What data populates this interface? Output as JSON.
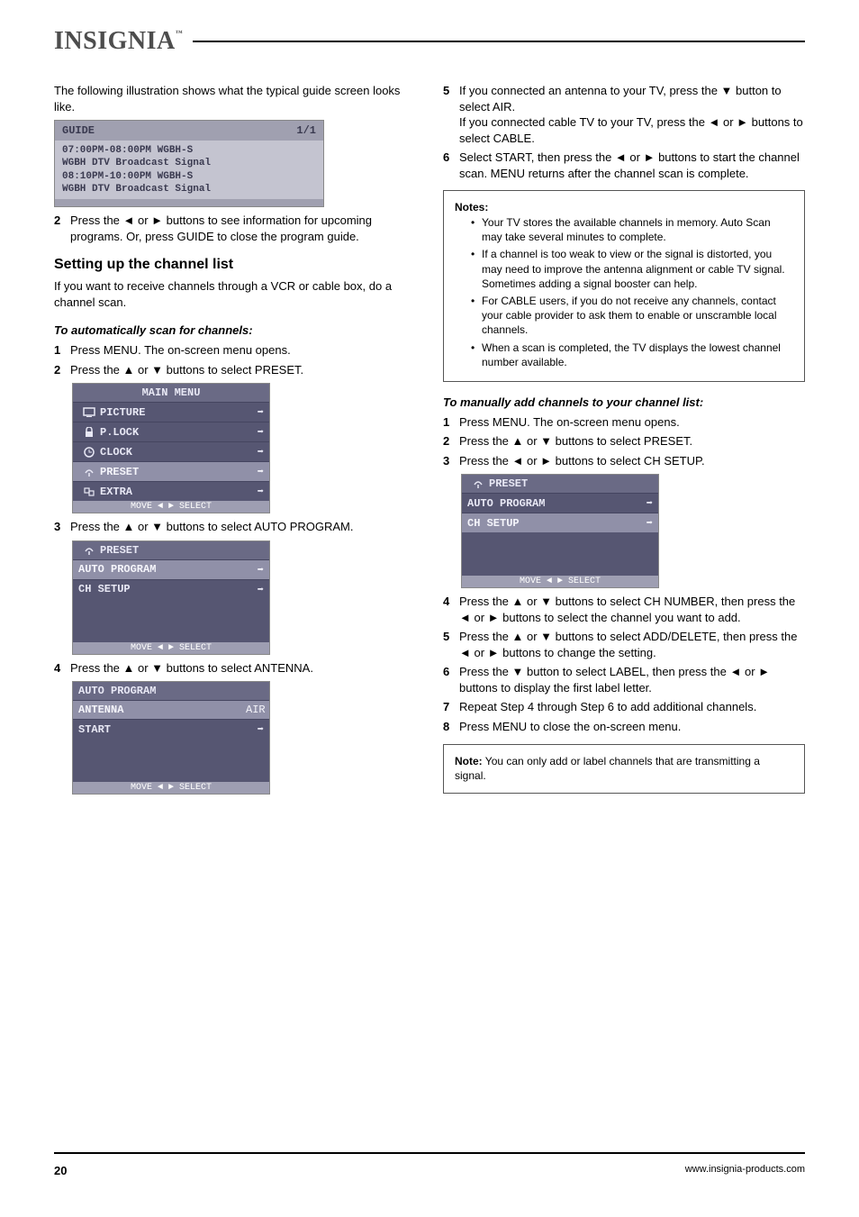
{
  "logo": {
    "brand": "INSIGNIA",
    "tm": "™"
  },
  "left_col": {
    "intro": "The following illustration shows what the typical guide screen looks like.",
    "guide_box": {
      "title": "GUIDE",
      "page": "1/1",
      "lines": [
        "07:00PM-08:00PM  WGBH-S",
        "WGBH DTV Broadcast Signal",
        "08:10PM-10:00PM  WGBH-S",
        "WGBH DTV Broadcast Signal"
      ]
    },
    "step2": {
      "num": "2",
      "text": "Press the ◄ or ► buttons to see information for upcoming programs. Or, press GUIDE to close the program guide."
    },
    "section_title": "Setting up the channel list",
    "auto_heading": "To automatically scan for channels:",
    "auto_scan_caution": "If you want to receive channels through a VCR or cable box, do a channel scan.",
    "s1": {
      "num": "1",
      "text": "Press MENU. The on-screen menu opens."
    },
    "s2": {
      "num": "2",
      "text": "Press the ▲ or ▼ buttons to select PRESET."
    },
    "main_menu": {
      "title": "MAIN MENU",
      "rows": [
        {
          "icon": "picture",
          "label": "PICTURE",
          "arrow": "→"
        },
        {
          "icon": "lock",
          "label": "P.LOCK",
          "arrow": "→"
        },
        {
          "icon": "clock",
          "label": "CLOCK",
          "arrow": "→"
        },
        {
          "icon": "preset",
          "label": "PRESET",
          "arrow": "→",
          "hl": true
        },
        {
          "icon": "extra",
          "label": "EXTRA",
          "arrow": "→"
        }
      ],
      "footer": "MOVE ◄ ► SELECT"
    },
    "s3": {
      "num": "3",
      "text": "Press the ▲ or ▼ buttons to select AUTO PROGRAM."
    },
    "preset_menu": {
      "title": "PRESET",
      "rows": [
        {
          "label": "AUTO PROGRAM",
          "arrow": "→",
          "hl": true
        },
        {
          "label": "CH SETUP",
          "arrow": "→"
        }
      ],
      "footer": "MOVE ◄ ► SELECT"
    },
    "s4": {
      "num": "4",
      "text": "Press the ▲ or ▼ buttons to select ANTENNA."
    },
    "autoprog_menu": {
      "title": "AUTO PROGRAM",
      "rows": [
        {
          "label": "ANTENNA",
          "value": "AIR",
          "hl": true
        },
        {
          "label": "START",
          "arrow": "→"
        }
      ],
      "footer": "MOVE ◄ ► SELECT"
    }
  },
  "right_col": {
    "s5": {
      "num": "5",
      "lines": [
        "If you connected an antenna to your TV, press the ▼ button to select AIR.",
        "If you connected cable TV to your TV, press the ◄ or ► buttons to select CABLE."
      ]
    },
    "s6": {
      "num": "6",
      "text": "Select START, then press the ◄ or ► buttons to start the channel scan. MENU returns after the channel scan is complete."
    },
    "notes_box": {
      "label": "Notes:",
      "items": [
        "Your TV stores the available channels in memory. Auto Scan may take several minutes to complete.",
        "If a channel is too weak to view or the signal is distorted, you may need to improve the antenna alignment or cable TV signal. Sometimes adding a signal booster can help.",
        "For CABLE users, if you do not receive any channels, contact your cable provider to ask them to enable or unscramble local channels.",
        "When a scan is completed, the TV displays the lowest channel number available."
      ]
    },
    "add_heading": "To manually add channels to your channel list:",
    "m1": {
      "num": "1",
      "text": "Press MENU. The on-screen menu opens."
    },
    "m2": {
      "num": "2",
      "text": "Press the ▲ or ▼ buttons to select PRESET."
    },
    "m3": {
      "num": "3",
      "text": "Press the ◄ or ► buttons to select CH SETUP."
    },
    "preset_menu2": {
      "title": "PRESET",
      "rows": [
        {
          "label": "AUTO PROGRAM",
          "arrow": "→"
        },
        {
          "label": "CH SETUP",
          "arrow": "→",
          "hl": true
        }
      ],
      "footer": "MOVE ◄ ► SELECT"
    },
    "m4": {
      "num": "4",
      "text": "Press the ▲ or ▼ buttons to select CH NUMBER, then press the ◄ or ► buttons to select the channel you want to add."
    },
    "m5": {
      "num": "5",
      "text": "Press the ▲ or ▼ buttons to select ADD/DELETE, then press the ◄ or ► buttons to change the setting."
    },
    "m6": {
      "num": "6",
      "text": "Press the ▼ button to select LABEL, then press the ◄ or ► buttons to display the first label letter."
    },
    "m7": {
      "num": "7",
      "text": "Repeat Step 4 through Step 6 to add additional channels."
    },
    "m8": {
      "num": "8",
      "text": "Press MENU to close the on-screen menu."
    },
    "note_single": {
      "label": "Note:",
      "text": "You can only add or label channels that are transmitting a signal."
    }
  },
  "footer": {
    "page": "20",
    "link": "www.insignia-products.com"
  }
}
